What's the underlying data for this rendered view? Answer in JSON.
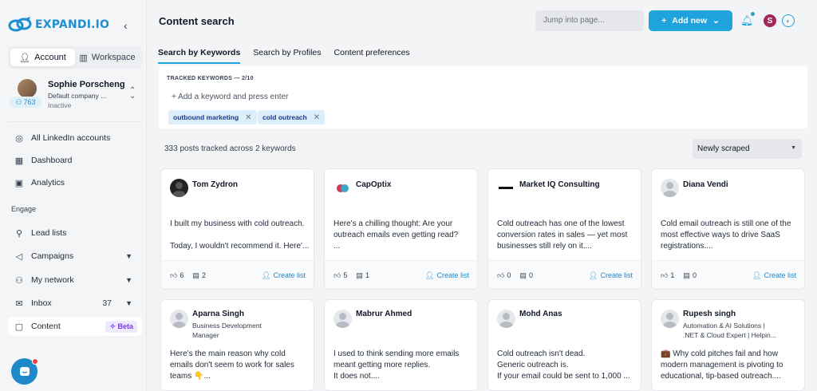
{
  "brand": {
    "name": "EXPANDI.IO"
  },
  "sidebar": {
    "toggle": {
      "account": "Account",
      "workspace": "Workspace"
    },
    "profile": {
      "name": "Sophie Porscheng",
      "company": "Default company ...",
      "status": "Inactive",
      "connections": "763"
    },
    "items": [
      {
        "label": "All LinkedIn accounts"
      },
      {
        "label": "Dashboard"
      },
      {
        "label": "Analytics"
      }
    ],
    "section_label": "Engage",
    "engage": [
      {
        "label": "Lead lists"
      },
      {
        "label": "Campaigns"
      },
      {
        "label": "My network"
      },
      {
        "label": "Inbox",
        "count": "37"
      },
      {
        "label": "Content",
        "badge": "Beta"
      }
    ]
  },
  "header": {
    "title": "Content search",
    "jump_placeholder": "Jump into page...",
    "add_new": "Add new",
    "user_initial": "S"
  },
  "tabs": [
    "Search by Keywords",
    "Search by Profiles",
    "Content preferences"
  ],
  "keywords": {
    "label": "TRACKED KEYWORDS — 2/10",
    "input_placeholder": "+ Add a keyword and press enter",
    "chips": [
      "outbound marketing",
      "cold outreach"
    ]
  },
  "summary": "333 posts tracked across 2 keywords",
  "sort": "Newly scraped",
  "cards": [
    {
      "name": "Tom Zydron",
      "sub": "",
      "text1": "I built my business with cold outreach.",
      "text2": "Today, I wouldn't recommend it. Here'...",
      "likes": "6",
      "comments": "2",
      "action": "Create list"
    },
    {
      "name": "CapOptix",
      "sub": "",
      "text1": "Here's a chilling thought: Are your",
      "text2": "outreach emails even getting read?",
      "text3": "...",
      "likes": "5",
      "comments": "1",
      "action": "Create list"
    },
    {
      "name": "Market IQ Consulting",
      "sub": "",
      "text1": "Cold outreach has one of the lowest",
      "text2": "conversion rates in sales — yet most",
      "text3": "businesses still rely on it....",
      "likes": "0",
      "comments": "0",
      "action": "Create list"
    },
    {
      "name": "Diana Vendi",
      "sub": "",
      "text1": "Cold email outreach is still one of the",
      "text2": "most effective ways to drive SaaS",
      "text3": "registrations....",
      "likes": "1",
      "comments": "0",
      "action": "Create list"
    },
    {
      "name": "Aparna Singh",
      "sub1": "Business Development",
      "sub2": "Manager",
      "text1": "Here's the main reason why cold",
      "text2": "emails don't seem to work for sales",
      "text3": "teams 👇..."
    },
    {
      "name": "Mabrur Ahmed",
      "sub": "",
      "text1": "I used to think sending more emails",
      "text2": "meant getting more replies.",
      "text3": "It does not...."
    },
    {
      "name": "Mohd Anas",
      "sub": "",
      "text1": "Cold outreach isn't dead.",
      "text2": "Generic outreach is.",
      "text3": "If your email could be sent to 1,000 ..."
    },
    {
      "name": "Rupesh singh",
      "sub1": "Automation & AI Solutions |",
      "sub2": ".NET & Cloud Expert | Helpin...",
      "text1": "💼 Why cold pitches fail and how",
      "text2": "modern management is pivoting to",
      "text3": "educational, tip-based outreach...."
    }
  ],
  "colors": {
    "accent": "#1ea3dd",
    "beta": "#7c3aed"
  }
}
